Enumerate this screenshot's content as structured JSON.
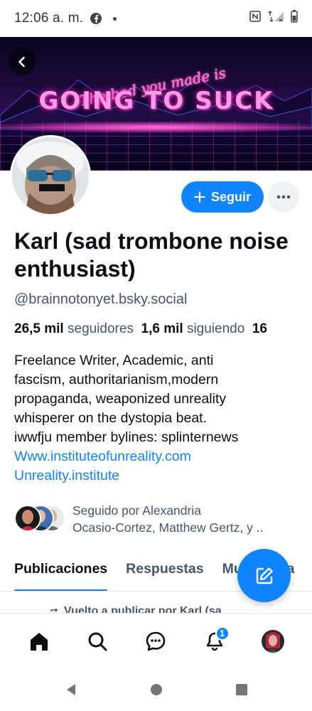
{
  "status_bar": {
    "time": "12:06 a. m."
  },
  "banner": {
    "script_text": "The bed you made is",
    "bold_text": "GOING TO SUCK"
  },
  "profile": {
    "display_name": "Karl (sad trombone noise enthusiast)",
    "handle": "@brainnotonyet.bsky.social",
    "followers_count": "26,5 mil",
    "followers_label": "seguidores",
    "following_count": "1,6 mil",
    "following_label": "siguiendo",
    "posts_count_partial": "16",
    "bio_lines": [
      "Freelance Writer, Academic, anti",
      "fascism, authoritarianism,modern",
      "propaganda, weaponized unreality",
      "whisperer on the dystopia beat.",
      "iwwfju member bylines: splinternews"
    ],
    "links": [
      "Www.instituteofunreality.com",
      "Unreality.institute"
    ]
  },
  "actions": {
    "follow_label": "Seguir"
  },
  "followed_by": {
    "line1": "Seguido por Alexandria",
    "line2": "Ocasio-Cortez, Matthew Gertz, y .."
  },
  "tabs": [
    {
      "label": "Publicaciones",
      "active": true
    },
    {
      "label": "Respuestas",
      "active": false
    },
    {
      "label": "Multimedia",
      "active": false
    }
  ],
  "feed": {
    "repost_text": "Vuelto a publicar por Karl (sa"
  },
  "bottom_nav": {
    "notifications_badge": "1"
  },
  "colors": {
    "accent": "#1083fe",
    "muted": "#42576c",
    "text": "#0b0f14"
  }
}
